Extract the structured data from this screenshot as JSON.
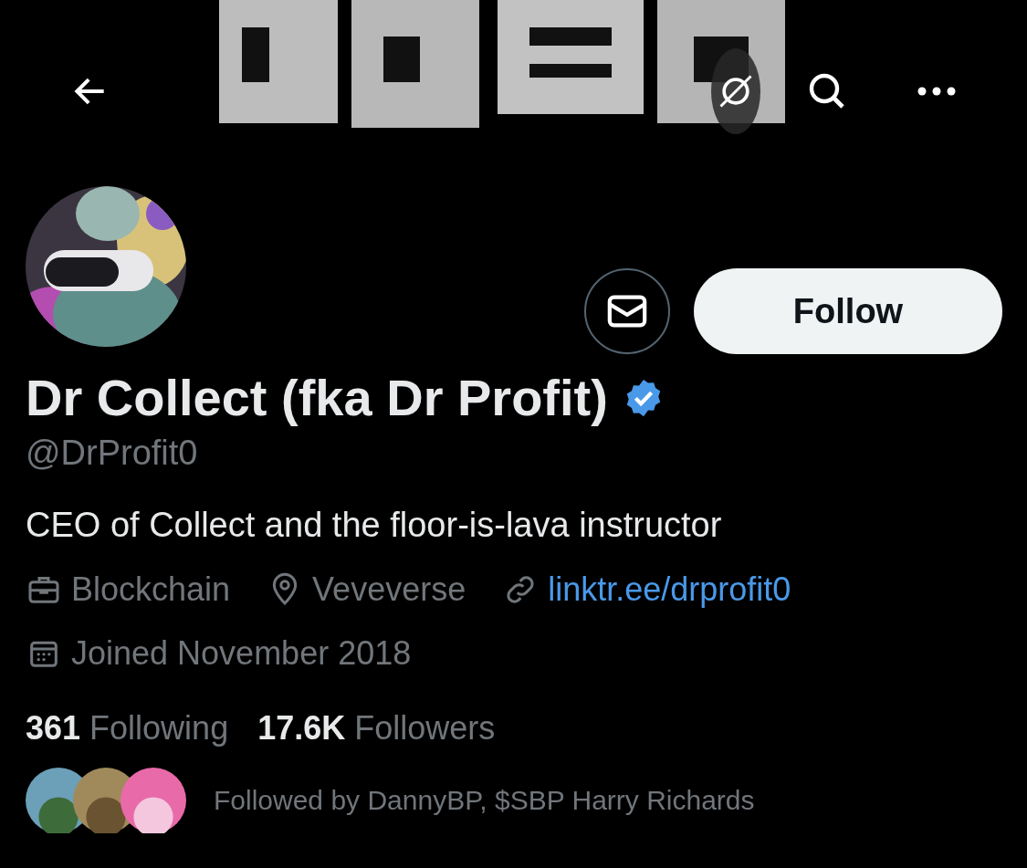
{
  "profile": {
    "name": "Dr Collect (fka Dr Profit)",
    "verified": true,
    "handle": "@DrProfit0",
    "bio": "CEO of Collect and the floor-is-lava instructor",
    "meta": [
      {
        "kind": "work",
        "text": "Blockchain"
      },
      {
        "kind": "location",
        "text": "Veveverse"
      },
      {
        "kind": "link",
        "text": "linktr.ee/drprofit0"
      }
    ],
    "joined": "Joined November 2018",
    "stats": [
      {
        "count": "361",
        "label": "Following"
      },
      {
        "count": "17.6K",
        "label": "Followers"
      }
    ],
    "followed_by": "Followed by DannyBP, $SBP Harry Richards"
  },
  "follow_button": {
    "label": "Follow"
  }
}
